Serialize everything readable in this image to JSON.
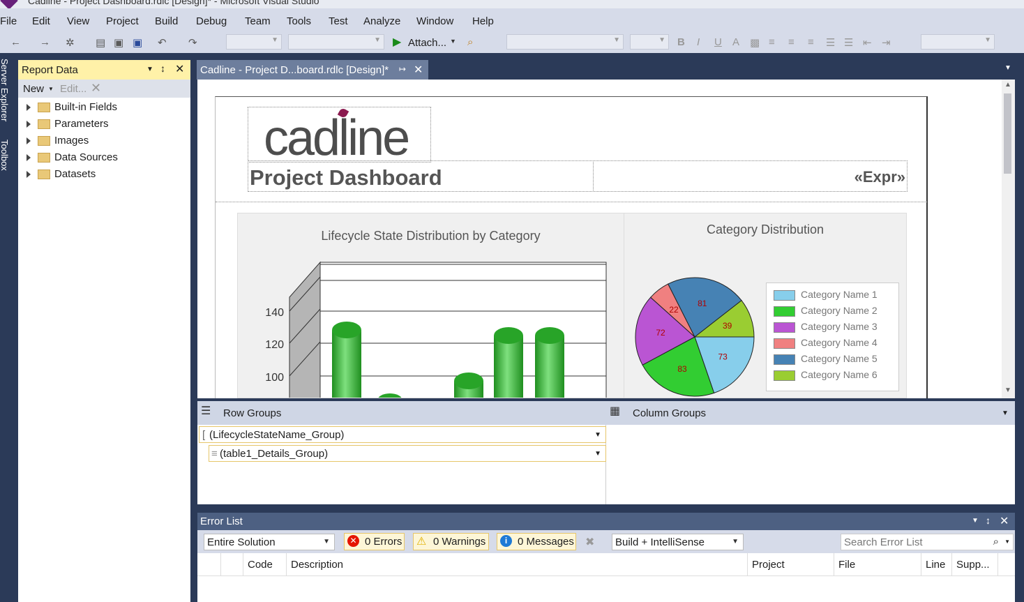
{
  "window": {
    "title": "Cadline - Project Dashboard.rdlc [Design]* - Microsoft Visual Studio"
  },
  "menu": [
    "File",
    "Edit",
    "View",
    "Project",
    "Build",
    "Debug",
    "Team",
    "Tools",
    "Test",
    "Analyze",
    "Window",
    "Help"
  ],
  "toolbar": {
    "attach_label": "Attach...",
    "bold": "B",
    "italic": "I",
    "underline": "U",
    "font_color": "A"
  },
  "side_tabs": {
    "server_explorer": "Server Explorer",
    "toolbox": "Toolbox"
  },
  "report_data": {
    "title": "Report Data",
    "new_label": "New",
    "edit_label": "Edit...",
    "items": [
      {
        "label": "Built-in Fields"
      },
      {
        "label": "Parameters"
      },
      {
        "label": "Images"
      },
      {
        "label": "Data Sources"
      },
      {
        "label": "Datasets"
      }
    ]
  },
  "doc_tab": {
    "label": "Cadline - Project D...board.rdlc [Design]*"
  },
  "report": {
    "logo_text": "cadline",
    "title": "Project Dashboard",
    "expr": "«Expr»"
  },
  "chart_data": [
    {
      "type": "bar",
      "title": "Lifecycle State Distribution by Category",
      "y_ticks": [
        "140",
        "120",
        "100"
      ]
    },
    {
      "type": "pie",
      "title": "Category Distribution",
      "slices": [
        {
          "name": "Category Name 1",
          "value": 73,
          "color": "#87ceeb"
        },
        {
          "name": "Category Name 2",
          "value": 83,
          "color": "#32cd32"
        },
        {
          "name": "Category Name 3",
          "value": 72,
          "color": "#ba55d3"
        },
        {
          "name": "Category Name 4",
          "value": 22,
          "color": "#f08080"
        },
        {
          "name": "Category Name 5",
          "value": 81,
          "color": "#4682b4"
        },
        {
          "name": "Category Name 6",
          "value": 39,
          "color": "#9acd32"
        }
      ]
    }
  ],
  "groups": {
    "row_label": "Row Groups",
    "column_label": "Column Groups",
    "row_items": [
      "(LifecycleStateName_Group)",
      "(table1_Details_Group)"
    ]
  },
  "error_list": {
    "title": "Error List",
    "scope": "Entire Solution",
    "errors": "0 Errors",
    "warnings": "0 Warnings",
    "messages": "0 Messages",
    "build_filter": "Build + IntelliSense",
    "search_placeholder": "Search Error List",
    "columns": [
      "Code",
      "Description",
      "Project",
      "File",
      "Line",
      "Supp..."
    ]
  }
}
